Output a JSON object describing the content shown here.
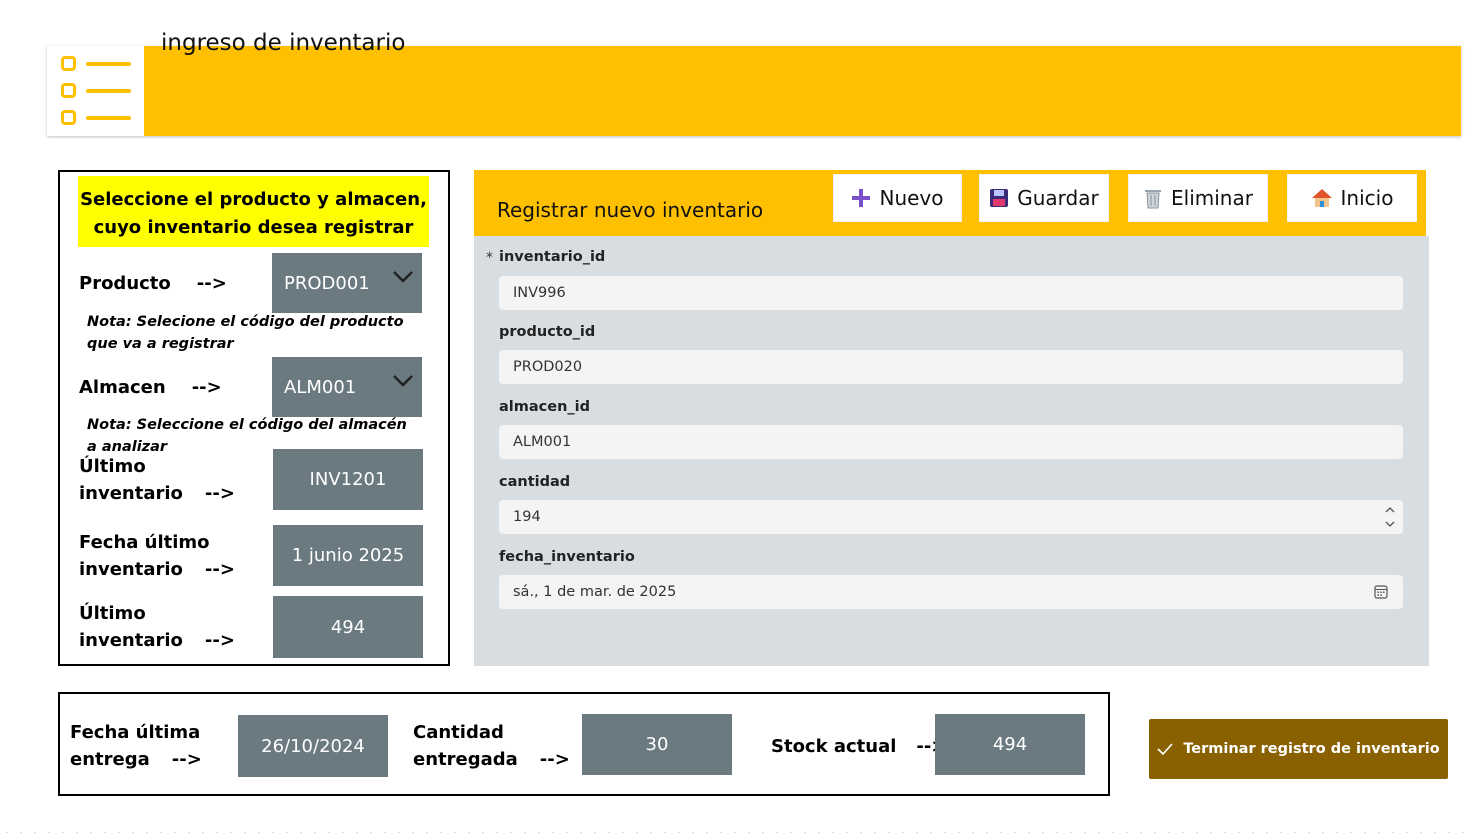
{
  "header": {
    "title": "ingreso de inventario",
    "icon": "list-icon",
    "accent": "#ffc000"
  },
  "selection": {
    "instruction_line1": "Seleccione el producto y almacen,",
    "instruction_line2": "cuyo inventario desea registrar",
    "producto_label": "Producto",
    "almacen_label": "Almacen",
    "arrow": "-->",
    "producto_value": "PROD001",
    "almacen_value": "ALM001",
    "producto_note": "Nota: Selecione el código del producto que va a registrar",
    "almacen_note": "Nota: Seleccione el código del almacén a analizar",
    "ultimo_line1": "Último",
    "ultimo_line2": "inventario",
    "ultimo_value": "INV1201",
    "fecha_line1": "Fecha último",
    "fecha_line2": "inventario",
    "fecha_value": "1 junio 2025",
    "ultimo2_line1": "Último",
    "ultimo2_line2": "inventario",
    "ultimo2_value": "494"
  },
  "form": {
    "title": "Registrar nuevo inventario",
    "buttons": {
      "nuevo": "Nuevo",
      "guardar": "Guardar",
      "eliminar": "Eliminar",
      "inicio": "Inicio"
    },
    "required_mark": "*",
    "fields": {
      "inventario_id": {
        "label": "inventario_id",
        "value": "INV996"
      },
      "producto_id": {
        "label": "producto_id",
        "value": "PROD020"
      },
      "almacen_id": {
        "label": "almacen_id",
        "value": "ALM001"
      },
      "cantidad": {
        "label": "cantidad",
        "value": "194"
      },
      "fecha_inventario": {
        "label": "fecha_inventario",
        "value": "sá., 1 de mar. de 2025"
      }
    }
  },
  "bottom": {
    "fecha_entrega_line1": "Fecha última",
    "fecha_entrega_line2": "entrega",
    "fecha_entrega_value": "26/10/2024",
    "cantidad_line1": "Cantidad",
    "cantidad_line2": "entregada",
    "cantidad_value": "30",
    "stock_label": "Stock actual",
    "stock_value": "494",
    "arrow": "-->"
  },
  "finish_button": {
    "label": "Terminar registro de inventario",
    "color": "#8a6100"
  }
}
